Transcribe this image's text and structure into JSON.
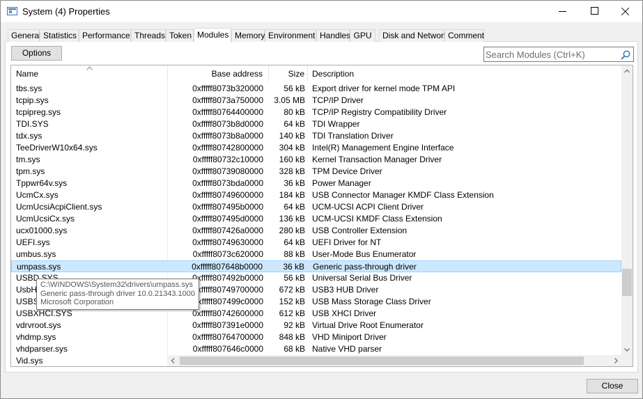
{
  "window": {
    "title": "System (4) Properties"
  },
  "tabs": [
    "General",
    "Statistics",
    "Performance",
    "Threads",
    "Token",
    "Modules",
    "Memory",
    "Environment",
    "Handles",
    "GPU",
    "Disk and Network",
    "Comment"
  ],
  "active_tab": "Modules",
  "toolbar": {
    "options_label": "Options",
    "search_placeholder": "Search Modules (Ctrl+K)"
  },
  "columns": {
    "name": "Name",
    "base": "Base address",
    "size": "Size",
    "desc": "Description"
  },
  "rows": [
    {
      "name": "tbs.sys",
      "base": "0xfffff8073b320000",
      "size": "56 kB",
      "desc": "Export driver for kernel mode TPM API"
    },
    {
      "name": "tcpip.sys",
      "base": "0xfffff8073a750000",
      "size": "3.05 MB",
      "desc": "TCP/IP Driver"
    },
    {
      "name": "tcpipreg.sys",
      "base": "0xfffff80764400000",
      "size": "80 kB",
      "desc": "TCP/IP Registry Compatibility Driver"
    },
    {
      "name": "TDI.SYS",
      "base": "0xfffff8073b8d0000",
      "size": "64 kB",
      "desc": "TDI Wrapper"
    },
    {
      "name": "tdx.sys",
      "base": "0xfffff8073b8a0000",
      "size": "140 kB",
      "desc": "TDI Translation Driver"
    },
    {
      "name": "TeeDriverW10x64.sys",
      "base": "0xfffff80742800000",
      "size": "304 kB",
      "desc": "Intel(R) Management Engine Interface"
    },
    {
      "name": "tm.sys",
      "base": "0xfffff80732c10000",
      "size": "160 kB",
      "desc": "Kernel Transaction Manager Driver"
    },
    {
      "name": "tpm.sys",
      "base": "0xfffff80739080000",
      "size": "328 kB",
      "desc": "TPM Device Driver"
    },
    {
      "name": "Tppwr64v.sys",
      "base": "0xfffff8073bda0000",
      "size": "36 kB",
      "desc": "Power Manager"
    },
    {
      "name": "UcmCx.sys",
      "base": "0xfffff80749600000",
      "size": "184 kB",
      "desc": "USB Connector Manager KMDF Class Extension"
    },
    {
      "name": "UcmUcsiAcpiClient.sys",
      "base": "0xfffff807495b0000",
      "size": "64 kB",
      "desc": "UCM-UCSI ACPI Client Driver"
    },
    {
      "name": "UcmUcsiCx.sys",
      "base": "0xfffff807495d0000",
      "size": "136 kB",
      "desc": "UCM-UCSI KMDF Class Extension"
    },
    {
      "name": "ucx01000.sys",
      "base": "0xfffff807426a0000",
      "size": "280 kB",
      "desc": "USB Controller Extension"
    },
    {
      "name": "UEFI.sys",
      "base": "0xfffff80749630000",
      "size": "64 kB",
      "desc": "UEFI Driver for NT"
    },
    {
      "name": "umbus.sys",
      "base": "0xfffff8073c620000",
      "size": "88 kB",
      "desc": "User-Mode Bus Enumerator"
    },
    {
      "name": "umpass.sys",
      "base": "0xfffff807648b0000",
      "size": "36 kB",
      "desc": "Generic pass-through driver"
    },
    {
      "name": "USBD.SYS",
      "base": "0xfffff807492b0000",
      "size": "56 kB",
      "desc": "Universal Serial Bus Driver"
    },
    {
      "name": "UsbHu",
      "base": "0xfffff80749700000",
      "size": "672 kB",
      "desc": "USB3 HUB Driver"
    },
    {
      "name": "USBST",
      "base": "0xfffff807499c0000",
      "size": "152 kB",
      "desc": "USB Mass Storage Class Driver"
    },
    {
      "name": "USBXHCI.SYS",
      "base": "0xfffff80742600000",
      "size": "612 kB",
      "desc": "USB XHCI Driver"
    },
    {
      "name": "vdrvroot.sys",
      "base": "0xfffff807391e0000",
      "size": "92 kB",
      "desc": "Virtual Drive Root Enumerator"
    },
    {
      "name": "vhdmp.sys",
      "base": "0xfffff80764700000",
      "size": "848 kB",
      "desc": "VHD Miniport Driver"
    },
    {
      "name": "vhdparser.sys",
      "base": "0xfffff807646c0000",
      "size": "68 kB",
      "desc": "Native VHD parser"
    },
    {
      "name": "Vid.sys",
      "base": "",
      "size": "",
      "desc": ""
    }
  ],
  "selected_row": "umpass.sys",
  "tooltip": {
    "path": "C:\\WINDOWS\\System32\\drivers\\umpass.sys",
    "desc": "Generic pass-through driver 10.0.21343.1000",
    "company": "Microsoft Corporation"
  },
  "footer": {
    "close_label": "Close"
  }
}
